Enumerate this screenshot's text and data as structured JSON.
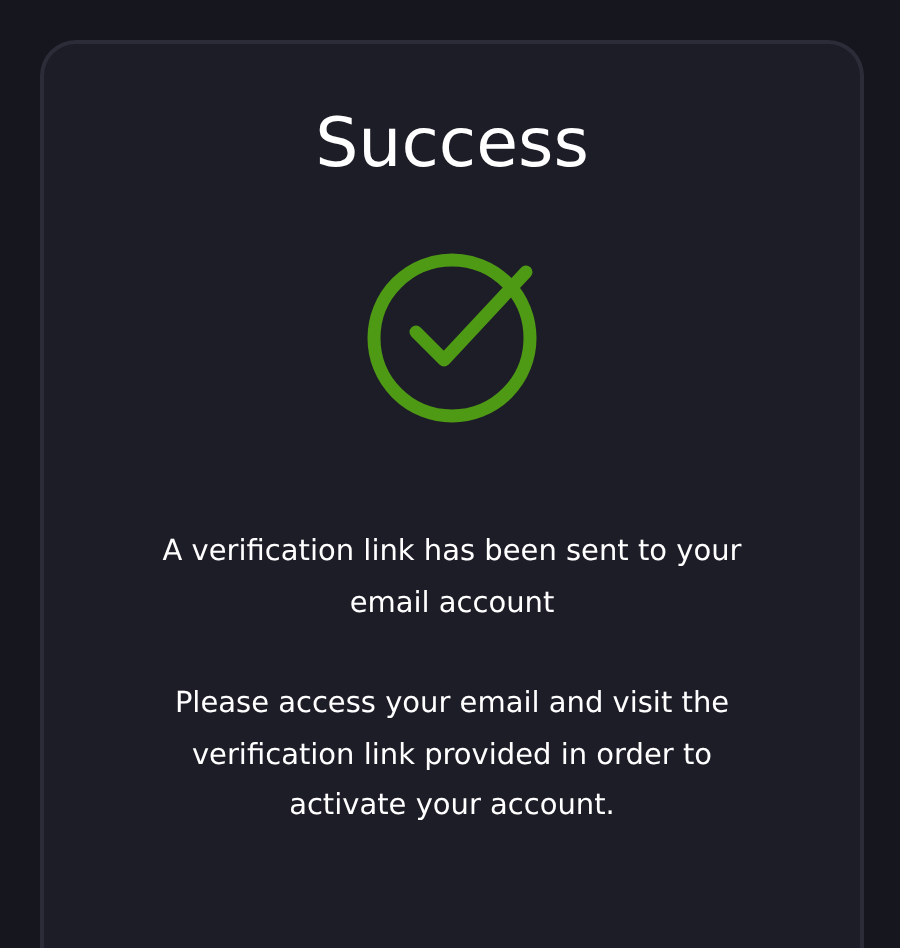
{
  "dialog": {
    "title": "Success",
    "success": true,
    "messages": [
      "A verification link has been sent to your email account",
      "Please access your email and visit the verification link provided in order to activate your account."
    ]
  }
}
